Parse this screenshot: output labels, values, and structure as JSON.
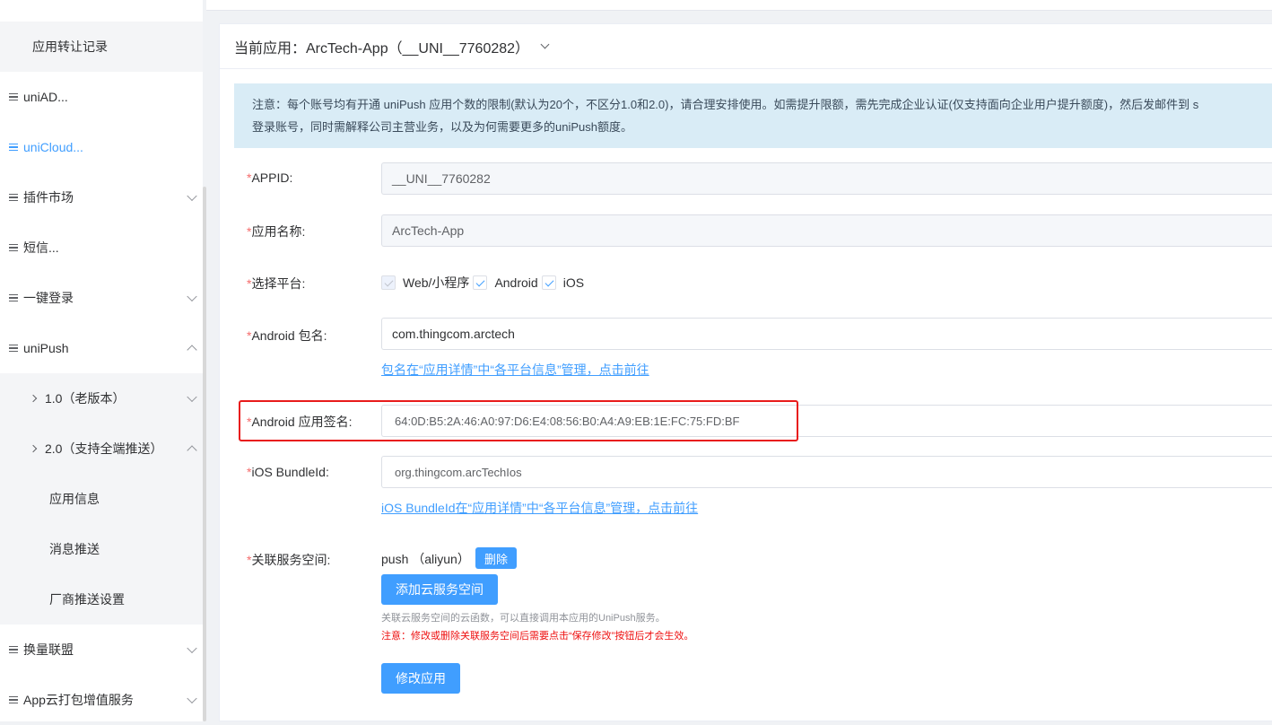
{
  "sidebar": {
    "items": [
      {
        "label": "应用转让记录"
      },
      {
        "label": "uniAD..."
      },
      {
        "label": "uniCloud..."
      },
      {
        "label": "插件市场"
      },
      {
        "label": "短信..."
      },
      {
        "label": "一键登录"
      },
      {
        "label": "uniPush"
      },
      {
        "label": "1.0（老版本）"
      },
      {
        "label": "2.0（支持全端推送）"
      },
      {
        "label": "应用信息"
      },
      {
        "label": "消息推送"
      },
      {
        "label": "厂商推送设置"
      },
      {
        "label": "换量联盟"
      },
      {
        "label": "App云打包增值服务"
      }
    ]
  },
  "header": {
    "current_app": "当前应用：ArcTech-App（__UNI__7760282）"
  },
  "notice": {
    "line1": "注意：每个账号均有开通 uniPush 应用个数的限制(默认为20个，不区分1.0和2.0)，请合理安排使用。如需提升限额，需先完成企业认证(仅支持面向企业用户提升额度)，然后发邮件到 s",
    "line2": "登录账号，同时需解释公司主营业务，以及为何需要更多的uniPush额度。"
  },
  "form": {
    "appid_label": "APPID:",
    "appid_value": "__UNI__7760282",
    "appname_label": "应用名称:",
    "appname_value": "ArcTech-App",
    "platform_label": "选择平台:",
    "platforms": [
      "Web/小程序",
      "Android",
      "iOS"
    ],
    "android_pkg_label": "Android 包名:",
    "android_pkg_value": "com.thingcom.arctech",
    "android_pkg_link": "包名在“应用详情”中“各平台信息”管理，点击前往",
    "android_sig_label": "Android 应用签名:",
    "android_sig_value": "64:0D:B5:2A:46:A0:97:D6:E4:08:56:B0:A4:A9:EB:1E:FC:75:FD:BF",
    "ios_bundle_label": "iOS BundleId:",
    "ios_bundle_value": "org.thingcom.arcTechIos",
    "ios_bundle_link": "iOS BundleId在“应用详情”中“各平台信息”管理，点击前往",
    "service_label": "关联服务空间:",
    "service_value": "push （aliyun）",
    "delete_label": "删除",
    "add_service_label": "添加云服务空间",
    "hint": "关联云服务空间的云函数，可以直接调用本应用的UniPush服务。",
    "warning": "注意：修改或删除关联服务空间后需要点击“保存修改”按钮后才会生效。",
    "submit_label": "修改应用",
    "required_mark": "*"
  },
  "colors": {
    "accent": "#409eff",
    "required": "#f56c6c",
    "highlight": "#e81b1b",
    "notice_bg": "#d9ecf6"
  }
}
